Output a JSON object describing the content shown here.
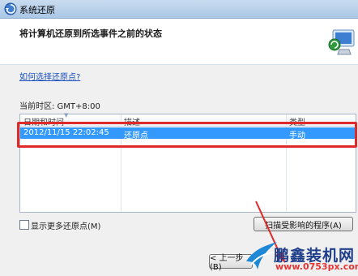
{
  "window": {
    "title": "系统还原"
  },
  "header": {
    "title": "将计算机还原到所选事件之前的状态"
  },
  "help_link": "如何选择还原点?",
  "timezone": "当前时区: GMT+8:00",
  "table": {
    "columns": [
      "日期和时间",
      "描述",
      "类型"
    ],
    "rows": [
      {
        "datetime": "2012/11/15 22:02:45",
        "description": "还原点",
        "type": "手动"
      }
    ],
    "selected_row_color": "#3399ff"
  },
  "show_more": {
    "label": "显示更多还原点(M)",
    "checked": false
  },
  "buttons": {
    "scan": "扫描受影响的程序(A)",
    "back": "< 上一步(B)"
  },
  "watermark": {
    "brand": "鹏鑫装机网",
    "url": "www.0753px.com"
  },
  "colors": {
    "highlight": "#e02a2a",
    "link": "#1a4fbf"
  }
}
